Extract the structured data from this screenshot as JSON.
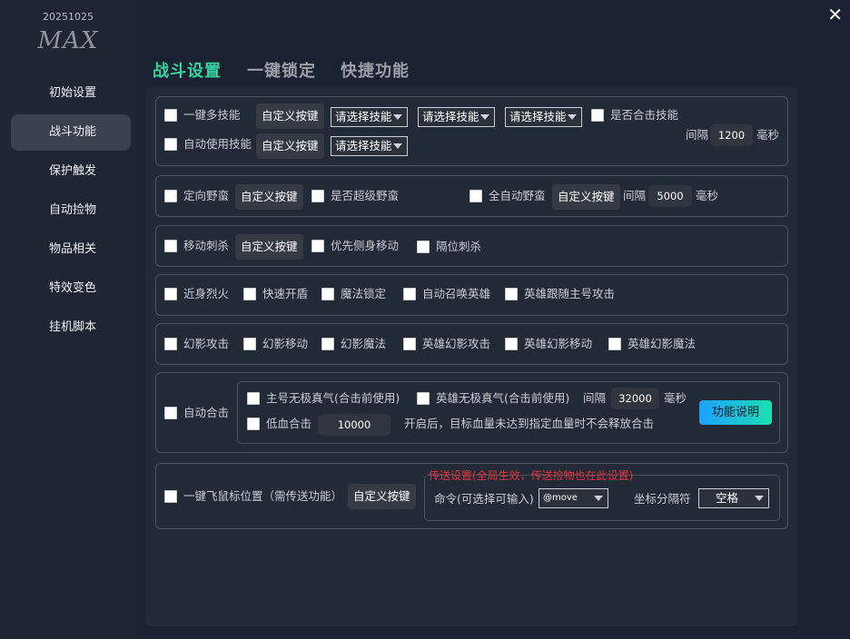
{
  "app": {
    "version": "20251025",
    "logo": "MAX",
    "close": "✕"
  },
  "sidebar": {
    "items": [
      {
        "label": "初始设置"
      },
      {
        "label": "战斗功能"
      },
      {
        "label": "保护触发"
      },
      {
        "label": "自动捡物"
      },
      {
        "label": "物品相关"
      },
      {
        "label": "特效变色"
      },
      {
        "label": "挂机脚本"
      }
    ]
  },
  "tabs": [
    {
      "label": "战斗设置"
    },
    {
      "label": "一键锁定"
    },
    {
      "label": "快捷功能"
    }
  ],
  "g1": {
    "multi_skill": "一键多技能",
    "custom_key": "自定义按键",
    "select_placeholder": "请选择技能",
    "combo_skill": "是否合击技能",
    "auto_skill": "自动使用技能",
    "interval_label": "间隔",
    "interval_value": "1200",
    "ms": "毫秒"
  },
  "g2": {
    "directed_rage": "定向野蛮",
    "custom_key": "自定义按键",
    "super_rage": "是否超级野蛮",
    "full_auto_rage": "全自动野蛮",
    "interval_label": "间隔",
    "interval_value": "5000",
    "ms": "毫秒"
  },
  "g3": {
    "move_stab": "移动刺杀",
    "custom_key": "自定义按键",
    "side_move": "优先侧身移动",
    "gap_stab": "隔位刺杀"
  },
  "g4": {
    "items": [
      "近身烈火",
      "快速开盾",
      "魔法锁定",
      "自动召唤英雄",
      "英雄跟随主号攻击"
    ]
  },
  "g5": {
    "items": [
      "幻影攻击",
      "幻影移动",
      "幻影魔法",
      "英雄幻影攻击",
      "英雄幻影移动",
      "英雄幻影魔法"
    ]
  },
  "g6": {
    "auto_combo": "自动合击",
    "main_zhenqi": "主号无极真气(合击前使用)",
    "hero_zhenqi": "英雄无极真气(合击前使用)",
    "interval_label": "间隔",
    "interval_value": "32000",
    "ms": "毫秒",
    "low_hp": "低血合击",
    "low_hp_value": "10000",
    "low_hp_note": "开启后，目标血量未达到指定血量时不会释放合击",
    "func_desc": "功能说明"
  },
  "g7": {
    "fly_mouse": "一键飞鼠标位置（需传送功能）",
    "custom_key": "自定义按键",
    "teleport_title": "传送设置(全局生效，传送捡物也在此设置)",
    "command_label": "命令(可选择可输入)",
    "command_value": "@move",
    "separator_label": "坐标分隔符",
    "separator_value": "空格"
  },
  "colors": {
    "accent": "#37d4a0",
    "warning": "#e5323c",
    "panel": "#222a37",
    "sidebar": "#1f2633"
  }
}
